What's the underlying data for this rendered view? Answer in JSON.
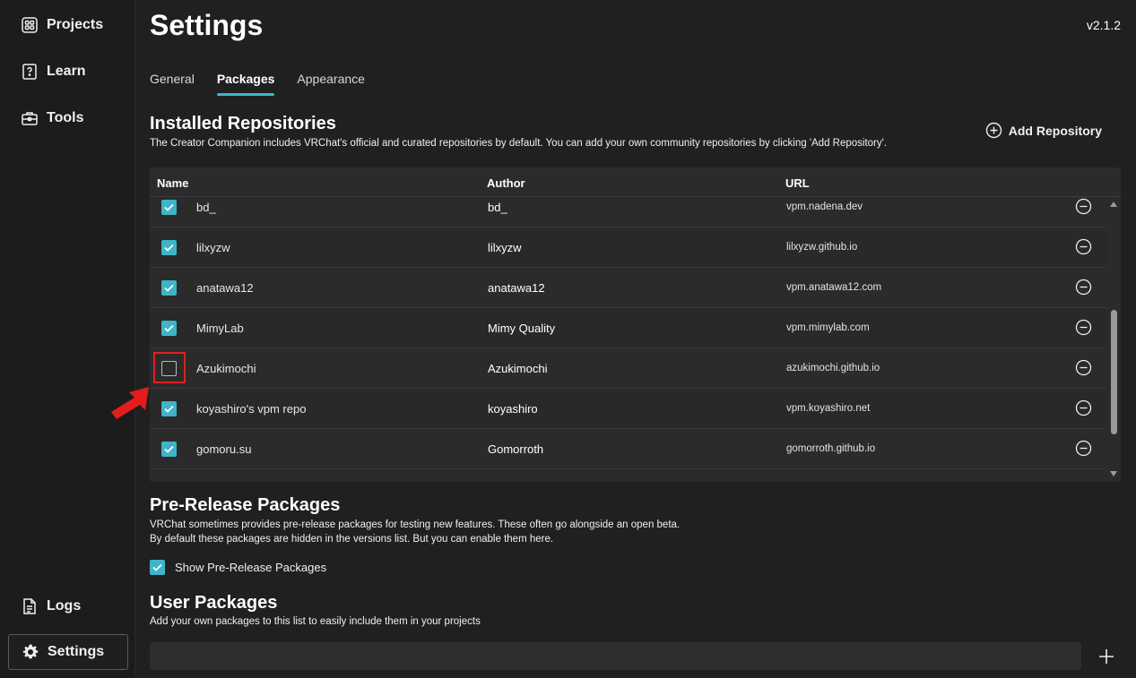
{
  "sidebar": {
    "items": [
      {
        "label": "Projects",
        "icon": "grid-icon"
      },
      {
        "label": "Learn",
        "icon": "question-book-icon"
      },
      {
        "label": "Tools",
        "icon": "toolbox-icon"
      }
    ],
    "bottom_items": [
      {
        "label": "Logs",
        "icon": "document-icon"
      },
      {
        "label": "Settings",
        "icon": "gear-icon",
        "active": true
      }
    ]
  },
  "header": {
    "title": "Settings",
    "version": "v2.1.2"
  },
  "tabs": [
    {
      "label": "General"
    },
    {
      "label": "Packages",
      "active": true
    },
    {
      "label": "Appearance"
    }
  ],
  "installed": {
    "title": "Installed Repositories",
    "description": "The Creator Companion includes VRChat's official and curated repositories by default. You can add your own community repositories by clicking 'Add Repository'.",
    "add_label": "Add Repository",
    "columns": {
      "name": "Name",
      "author": "Author",
      "url": "URL"
    },
    "rows": [
      {
        "name": "bd_",
        "author": "bd_",
        "url": "vpm.nadena.dev",
        "checked": true
      },
      {
        "name": "lilxyzw",
        "author": "lilxyzw",
        "url": "lilxyzw.github.io",
        "checked": true
      },
      {
        "name": "anatawa12",
        "author": "anatawa12",
        "url": "vpm.anatawa12.com",
        "checked": true
      },
      {
        "name": "MimyLab",
        "author": "Mimy Quality",
        "url": "vpm.mimylab.com",
        "checked": true
      },
      {
        "name": "Azukimochi",
        "author": "Azukimochi",
        "url": "azukimochi.github.io",
        "checked": false
      },
      {
        "name": "koyashiro's vpm repo",
        "author": "koyashiro",
        "url": "vpm.koyashiro.net",
        "checked": true
      },
      {
        "name": "gomoru.su",
        "author": "Gomorroth",
        "url": "gomorroth.github.io",
        "checked": true
      }
    ]
  },
  "prerelease": {
    "title": "Pre-Release Packages",
    "desc_line1": "VRChat sometimes provides pre-release packages for testing new features. These often go alongside an open beta.",
    "desc_line2": "By default these packages are hidden in the versions list. But you can enable them here.",
    "checkbox_label": "Show Pre-Release Packages",
    "checked": true
  },
  "user_packages": {
    "title": "User Packages",
    "description": "Add your own packages to this list to easily include them in your projects",
    "input_value": ""
  },
  "colors": {
    "accent": "#3fb4c8",
    "background": "#202020",
    "highlight": "#e02020"
  }
}
